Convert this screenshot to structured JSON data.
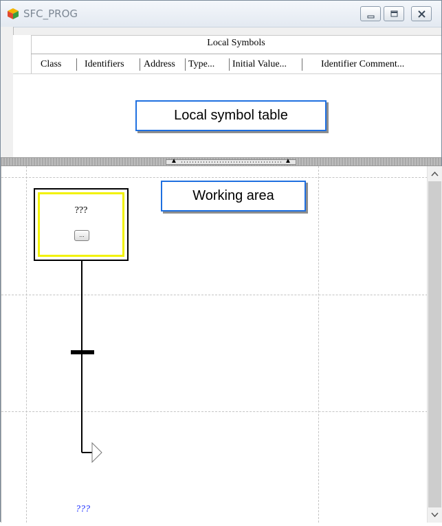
{
  "window": {
    "title": "SFC_PROG",
    "buttons": [
      "minimize",
      "maximize",
      "close"
    ]
  },
  "local_symbols": {
    "title": "Local Symbols",
    "columns": [
      "Class",
      "Identifiers",
      "Address",
      "Type...",
      "Initial Value...",
      "Identifier Comment..."
    ]
  },
  "sfc": {
    "step_name": "???",
    "action_button_label": "...",
    "jump_target": "???"
  },
  "callouts": {
    "local_symbol_table": "Local symbol table",
    "working_area": "Working area"
  },
  "colors": {
    "step_highlight": "#f2f200",
    "callout_border": "#1e6fe0",
    "jump_label": "#1a2cff"
  },
  "icons": [
    "app-cube-icon",
    "minimize-icon",
    "maximize-icon",
    "close-icon",
    "scroll-up-icon",
    "scroll-down-icon",
    "splitter-up-arrow-icon"
  ]
}
